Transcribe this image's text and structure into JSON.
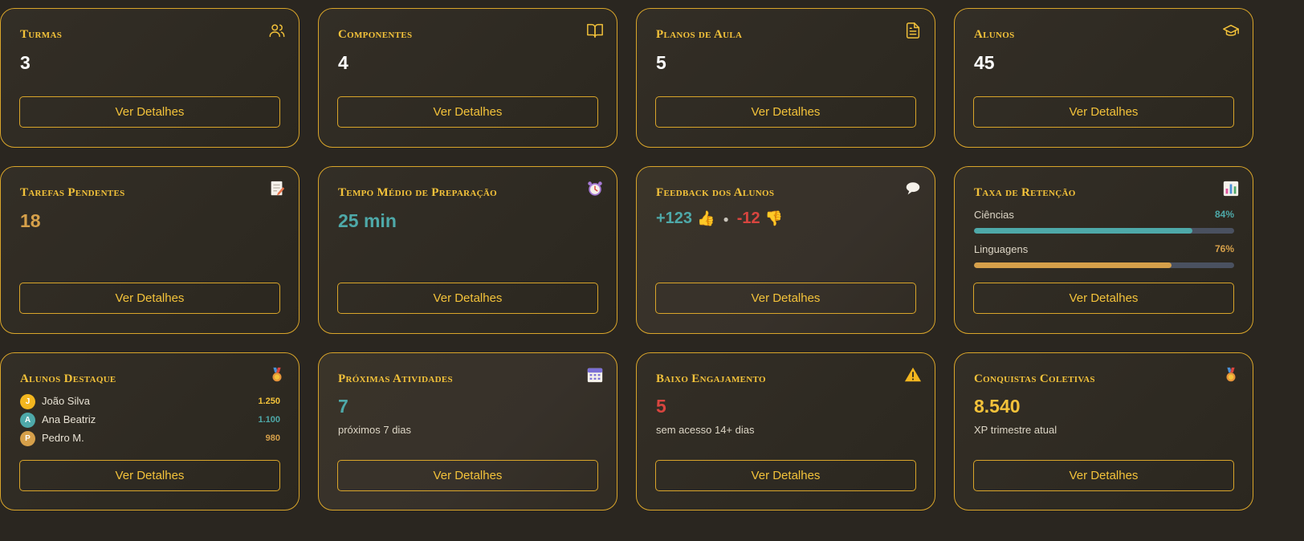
{
  "colors": {
    "accent": "#f3c23a",
    "border": "#d9a52a",
    "teal": "#4ea9a9",
    "orange": "#d6a04a",
    "red": "#d9453f",
    "white": "#ffffff"
  },
  "cards": {
    "turmas": {
      "title": "Turmas",
      "value": "3",
      "icon": "users-icon"
    },
    "componentes": {
      "title": "Componentes",
      "value": "4",
      "icon": "book-icon"
    },
    "planos": {
      "title": "Planos de Aula",
      "value": "5",
      "icon": "document-icon"
    },
    "alunos": {
      "title": "Alunos",
      "value": "45",
      "icon": "graduation-cap-icon"
    },
    "tarefas": {
      "title": "Tarefas Pendentes",
      "value": "18",
      "icon": "memo-icon"
    },
    "tempo": {
      "title": "Tempo Médio de Preparação",
      "value": "25 min",
      "icon": "alarm-clock-icon"
    },
    "feedback": {
      "title": "Feedback dos Alunos",
      "positive": "+123",
      "positive_emoji": "👍",
      "separator": "●",
      "negative": "-12",
      "negative_emoji": "👎",
      "icon": "speech-bubble-icon"
    },
    "retencao": {
      "title": "Taxa de Retenção",
      "icon": "bar-chart-icon",
      "items": [
        {
          "label": "Ciências",
          "percent_text": "84%",
          "percent": 84,
          "color": "#4ea9a9"
        },
        {
          "label": "Linguagens",
          "percent_text": "76%",
          "percent": 76,
          "color": "#d6a04a"
        }
      ]
    },
    "destaque": {
      "title": "Alunos Destaque",
      "icon": "medal-icon",
      "students": [
        {
          "initial": "J",
          "name": "João Silva",
          "xp": "1.250",
          "color": "#f3b61f",
          "xp_color": "#f3c23a"
        },
        {
          "initial": "A",
          "name": "Ana Beatriz",
          "xp": "1.100",
          "color": "#4ea9a9",
          "xp_color": "#4ea9a9"
        },
        {
          "initial": "P",
          "name": "Pedro M.",
          "xp": "980",
          "color": "#d6a04a",
          "xp_color": "#d6a04a"
        }
      ]
    },
    "proximas": {
      "title": "Próximas Atividades",
      "value": "7",
      "sub": "próximos 7 dias",
      "icon": "calendar-icon"
    },
    "baixo": {
      "title": "Baixo Engajamento",
      "value": "5",
      "sub": "sem acesso 14+ dias",
      "icon": "warning-icon"
    },
    "conquistas": {
      "title": "Conquistas Coletivas",
      "value": "8.540",
      "sub": "XP trimestre atual",
      "icon": "medal-icon"
    }
  },
  "button_label": "Ver Detalhes"
}
